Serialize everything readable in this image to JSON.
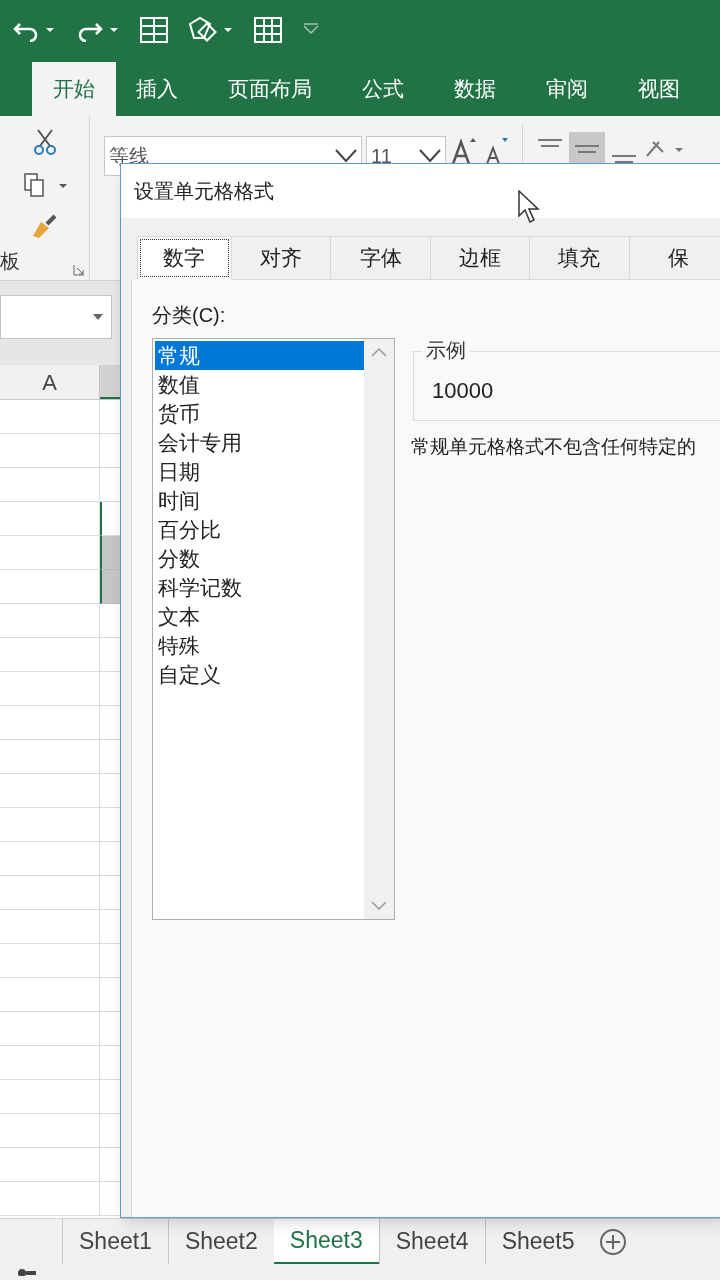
{
  "ribbon_tabs": [
    {
      "label": "开始",
      "selected": true
    },
    {
      "label": "插入",
      "selected": false
    },
    {
      "label": "页面布局",
      "selected": false
    },
    {
      "label": "公式",
      "selected": false
    },
    {
      "label": "数据",
      "selected": false
    },
    {
      "label": "审阅",
      "selected": false
    },
    {
      "label": "视图",
      "selected": false
    }
  ],
  "ribbon": {
    "font_name": "等线",
    "font_size": "11",
    "clipboard_group": "板"
  },
  "column_header": "A",
  "dialog": {
    "title": "设置单元格格式",
    "tabs": [
      {
        "label": "数字",
        "selected": true
      },
      {
        "label": "对齐",
        "selected": false
      },
      {
        "label": "字体",
        "selected": false
      },
      {
        "label": "边框",
        "selected": false
      },
      {
        "label": "填充",
        "selected": false
      },
      {
        "label": "保",
        "selected": false
      }
    ],
    "category_label": "分类(C):",
    "categories": [
      {
        "label": "常规",
        "selected": true
      },
      {
        "label": "数值",
        "selected": false
      },
      {
        "label": "货币",
        "selected": false
      },
      {
        "label": "会计专用",
        "selected": false
      },
      {
        "label": "日期",
        "selected": false
      },
      {
        "label": "时间",
        "selected": false
      },
      {
        "label": "百分比",
        "selected": false
      },
      {
        "label": "分数",
        "selected": false
      },
      {
        "label": "科学记数",
        "selected": false
      },
      {
        "label": "文本",
        "selected": false
      },
      {
        "label": "特殊",
        "selected": false
      },
      {
        "label": "自定义",
        "selected": false
      }
    ],
    "sample_label": "示例",
    "sample_value": "10000",
    "description": "常规单元格格式不包含任何特定的"
  },
  "sheet_tabs": [
    {
      "label": "Sheet1",
      "selected": false
    },
    {
      "label": "Sheet2",
      "selected": false
    },
    {
      "label": "Sheet3",
      "selected": true
    },
    {
      "label": "Sheet4",
      "selected": false
    },
    {
      "label": "Sheet5",
      "selected": false
    }
  ]
}
